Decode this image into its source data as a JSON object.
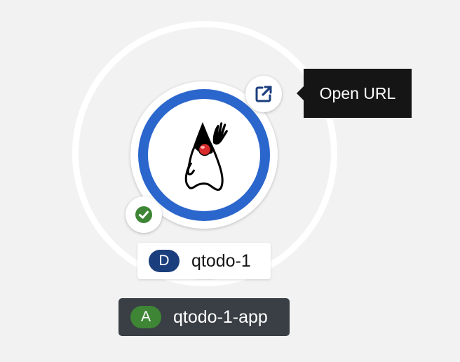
{
  "topology": {
    "tooltip": "Open URL",
    "node": {
      "name": "qtodo-1",
      "kind_badge": "D",
      "icon": "java-duke-icon",
      "status_icon": "check-circle-icon",
      "url_icon": "external-link-icon"
    },
    "application": {
      "name": "qtodo-1-app",
      "kind_badge": "A"
    }
  },
  "colors": {
    "node_ring": "#2b66cc",
    "deployment_badge": "#1b3e7d",
    "application_badge": "#3e8635",
    "status_ok": "#3e8635",
    "tooltip_bg": "#151515",
    "application_label_bg": "#393f44"
  }
}
